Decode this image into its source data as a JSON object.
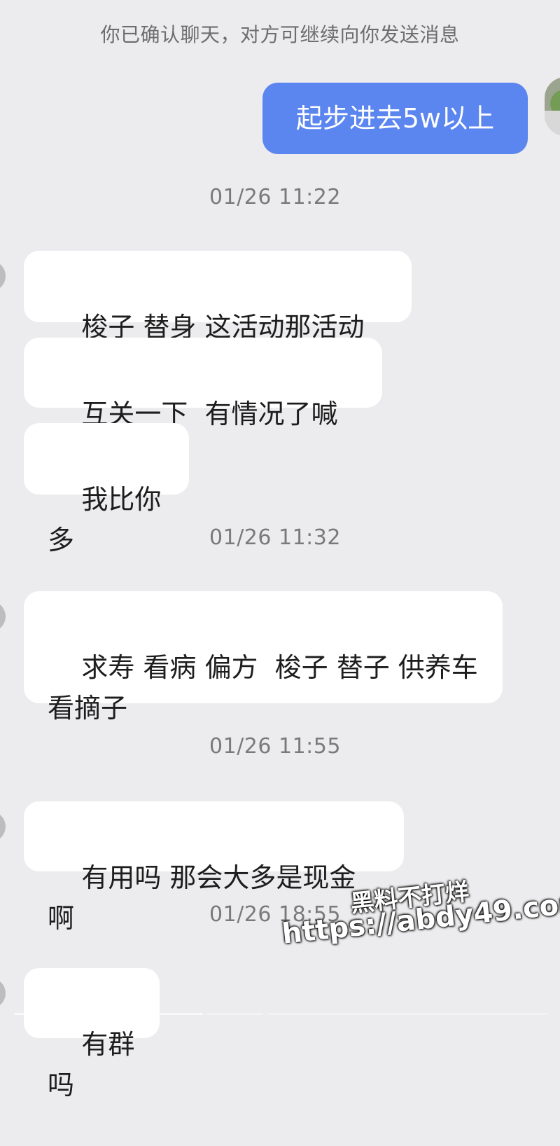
{
  "system_note": "你已确认聊天，对方可继续向你发送消息",
  "outgoing": [
    {
      "text": "起步进去5w以上"
    }
  ],
  "timestamps": [
    "01/26 11:22",
    "01/26 11:32",
    "01/26 11:55",
    "01/26 18:55"
  ],
  "incoming": [
    {
      "text": "梭子 替身 这活动那活动的"
    },
    {
      "text": "互关一下  有情况了喊我"
    },
    {
      "text": "我比你多"
    },
    {
      "text": "求寿 看病 偏方  梭子 替子 供养车\n看摘子"
    },
    {
      "text": "有用吗 那会大多是现金啊"
    },
    {
      "text": "有群吗"
    }
  ],
  "watermark": {
    "line1": "黑料不打烊",
    "line2": "https://abdy49.com"
  },
  "colors": {
    "background": "#ececee",
    "outgoing_bubble": "#5b85ef",
    "incoming_bubble": "#ffffff"
  }
}
